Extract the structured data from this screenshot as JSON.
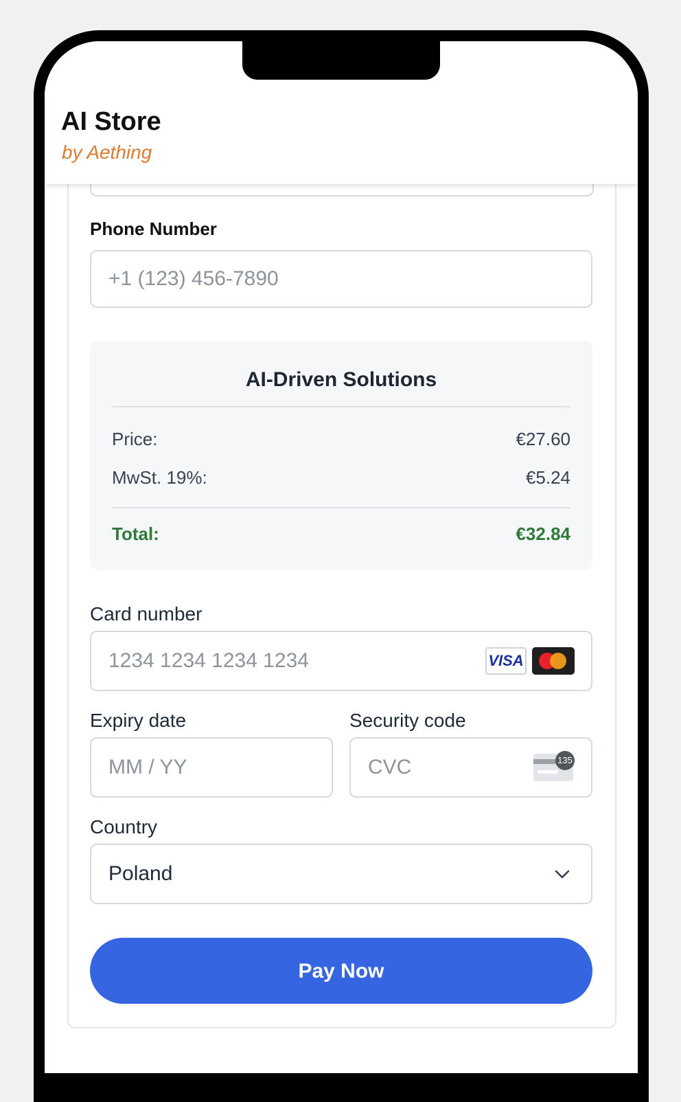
{
  "app": {
    "title": "AI Store",
    "subtitle": "by Aething"
  },
  "form": {
    "phone_label": "Phone Number",
    "phone_placeholder": "+1 (123) 456-7890"
  },
  "summary": {
    "title": "AI-Driven Solutions",
    "price_label": "Price:",
    "price_value": "€27.60",
    "tax_label": "MwSt. 19%:",
    "tax_value": "€5.24",
    "total_label": "Total:",
    "total_value": "€32.84",
    "total_color": "#2f7a3a"
  },
  "payment": {
    "card_label": "Card number",
    "card_placeholder": "1234 1234 1234 1234",
    "visa_text": "VISA",
    "expiry_label": "Expiry date",
    "expiry_placeholder": "MM / YY",
    "cvc_label": "Security code",
    "cvc_placeholder": "CVC",
    "cvc_badge": "135",
    "country_label": "Country",
    "country_value": "Poland",
    "card_icons": [
      "visa-icon",
      "mastercard-icon"
    ]
  },
  "actions": {
    "pay_label": "Pay Now",
    "accent": "#3565e0"
  }
}
